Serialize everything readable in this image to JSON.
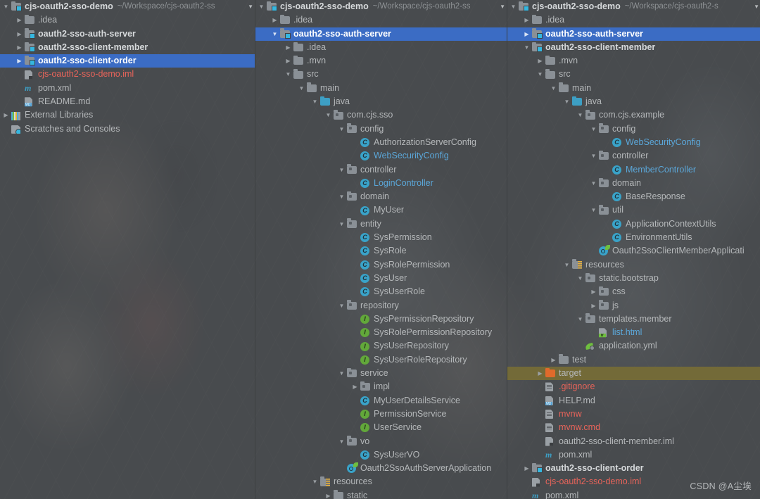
{
  "app": {
    "theme": "intellij-darcula",
    "colors": {
      "background": "#484b4e",
      "selection": "#3b6cc4",
      "target_highlight": "#736a38",
      "text": "#b5b8ba",
      "red_file": "#e8645a",
      "blue_file": "#5ba7d9",
      "class_icon": "#39a3c9",
      "interface_icon": "#62a83a"
    },
    "watermark": "CSDN @A尘埃"
  },
  "panels": [
    {
      "id": "panel-left",
      "header": {
        "label": "cjs-oauth2-sso-demo",
        "path": "~/Workspace/cjs-oauth2-ss",
        "caret": "▼"
      },
      "rows": [
        {
          "depth": 0,
          "arrow": "▼",
          "icon": "module-icon",
          "label": "cjs-oauth2-sso-demo",
          "sub": "~/Workspace/cjs-oauth2-ss",
          "bold": true,
          "color": "white"
        },
        {
          "depth": 1,
          "arrow": "▶",
          "icon": "folder-icon",
          "label": ".idea",
          "color": "plain"
        },
        {
          "depth": 1,
          "arrow": "▶",
          "icon": "module-icon",
          "label": "oauth2-sso-auth-server",
          "bold": true,
          "color": "white"
        },
        {
          "depth": 1,
          "arrow": "▶",
          "icon": "module-icon",
          "label": "oauth2-sso-client-member",
          "bold": true,
          "color": "white"
        },
        {
          "depth": 1,
          "arrow": "▶",
          "icon": "module-icon",
          "label": "oauth2-sso-client-order",
          "bold": true,
          "color": "white",
          "selected": true
        },
        {
          "depth": 1,
          "arrow": "",
          "icon": "iml-file-icon",
          "label": "cjs-oauth2-sso-demo.iml",
          "color": "red"
        },
        {
          "depth": 1,
          "arrow": "",
          "icon": "maven-pom-icon",
          "label": "pom.xml",
          "color": "plain"
        },
        {
          "depth": 1,
          "arrow": "",
          "icon": "markdown-file-icon",
          "label": "README.md",
          "color": "plain"
        },
        {
          "depth": 0,
          "arrow": "▶",
          "icon": "external-libraries-icon",
          "label": "External Libraries",
          "color": "plain"
        },
        {
          "depth": 0,
          "arrow": "",
          "icon": "scratches-icon",
          "label": "Scratches and Consoles",
          "color": "plain"
        }
      ]
    },
    {
      "id": "panel-middle",
      "header": {
        "label": "cjs-oauth2-sso-demo",
        "path": "~/Workspace/cjs-oauth2-ss",
        "caret": "▼"
      },
      "rows": [
        {
          "depth": 0,
          "arrow": "▼",
          "icon": "module-icon",
          "label": "cjs-oauth2-sso-demo",
          "sub": "~/Workspace/cjs-oauth2-ss",
          "bold": true,
          "color": "white"
        },
        {
          "depth": 1,
          "arrow": "▶",
          "icon": "folder-icon",
          "label": ".idea",
          "color": "plain"
        },
        {
          "depth": 1,
          "arrow": "▼",
          "icon": "module-icon",
          "label": "oauth2-sso-auth-server",
          "bold": true,
          "color": "white",
          "selected": true
        },
        {
          "depth": 2,
          "arrow": "▶",
          "icon": "folder-icon",
          "label": ".idea",
          "color": "plain"
        },
        {
          "depth": 2,
          "arrow": "▶",
          "icon": "folder-icon",
          "label": ".mvn",
          "color": "plain"
        },
        {
          "depth": 2,
          "arrow": "▼",
          "icon": "folder-icon",
          "label": "src",
          "color": "plain"
        },
        {
          "depth": 3,
          "arrow": "▼",
          "icon": "folder-icon",
          "label": "main",
          "color": "plain"
        },
        {
          "depth": 4,
          "arrow": "▼",
          "icon": "source-folder-icon",
          "label": "java",
          "color": "plain"
        },
        {
          "depth": 5,
          "arrow": "▼",
          "icon": "package-icon",
          "label": "com.cjs.sso",
          "color": "plain"
        },
        {
          "depth": 6,
          "arrow": "▼",
          "icon": "package-icon",
          "label": "config",
          "color": "plain"
        },
        {
          "depth": 7,
          "arrow": "",
          "icon": "class-icon",
          "label": "AuthorizationServerConfig",
          "color": "plain"
        },
        {
          "depth": 7,
          "arrow": "",
          "icon": "class-icon",
          "label": "WebSecurityConfig",
          "color": "blue"
        },
        {
          "depth": 6,
          "arrow": "▼",
          "icon": "package-icon",
          "label": "controller",
          "color": "plain"
        },
        {
          "depth": 7,
          "arrow": "",
          "icon": "class-icon",
          "label": "LoginController",
          "color": "blue"
        },
        {
          "depth": 6,
          "arrow": "▼",
          "icon": "package-icon",
          "label": "domain",
          "color": "plain"
        },
        {
          "depth": 7,
          "arrow": "",
          "icon": "class-icon",
          "label": "MyUser",
          "color": "plain"
        },
        {
          "depth": 6,
          "arrow": "▼",
          "icon": "package-icon",
          "label": "entity",
          "color": "plain"
        },
        {
          "depth": 7,
          "arrow": "",
          "icon": "class-icon",
          "label": "SysPermission",
          "color": "plain"
        },
        {
          "depth": 7,
          "arrow": "",
          "icon": "class-icon",
          "label": "SysRole",
          "color": "plain"
        },
        {
          "depth": 7,
          "arrow": "",
          "icon": "class-icon",
          "label": "SysRolePermission",
          "color": "plain"
        },
        {
          "depth": 7,
          "arrow": "",
          "icon": "class-icon",
          "label": "SysUser",
          "color": "plain"
        },
        {
          "depth": 7,
          "arrow": "",
          "icon": "class-icon",
          "label": "SysUserRole",
          "color": "plain"
        },
        {
          "depth": 6,
          "arrow": "▼",
          "icon": "package-icon",
          "label": "repository",
          "color": "plain"
        },
        {
          "depth": 7,
          "arrow": "",
          "icon": "interface-icon",
          "label": "SysPermissionRepository",
          "color": "plain"
        },
        {
          "depth": 7,
          "arrow": "",
          "icon": "interface-icon",
          "label": "SysRolePermissionRepository",
          "color": "plain"
        },
        {
          "depth": 7,
          "arrow": "",
          "icon": "interface-icon",
          "label": "SysUserRepository",
          "color": "plain"
        },
        {
          "depth": 7,
          "arrow": "",
          "icon": "interface-icon",
          "label": "SysUserRoleRepository",
          "color": "plain"
        },
        {
          "depth": 6,
          "arrow": "▼",
          "icon": "package-icon",
          "label": "service",
          "color": "plain"
        },
        {
          "depth": 7,
          "arrow": "▶",
          "icon": "package-icon",
          "label": "impl",
          "color": "plain"
        },
        {
          "depth": 7,
          "arrow": "",
          "icon": "class-icon",
          "label": "MyUserDetailsService",
          "color": "plain"
        },
        {
          "depth": 7,
          "arrow": "",
          "icon": "interface-icon",
          "label": "PermissionService",
          "color": "plain"
        },
        {
          "depth": 7,
          "arrow": "",
          "icon": "interface-icon",
          "label": "UserService",
          "color": "plain"
        },
        {
          "depth": 6,
          "arrow": "▼",
          "icon": "package-icon",
          "label": "vo",
          "color": "plain"
        },
        {
          "depth": 7,
          "arrow": "",
          "icon": "class-icon",
          "label": "SysUserVO",
          "color": "plain"
        },
        {
          "depth": 6,
          "arrow": "",
          "icon": "spring-boot-app-icon",
          "label": "Oauth2SsoAuthServerApplication",
          "color": "plain"
        },
        {
          "depth": 4,
          "arrow": "▼",
          "icon": "resources-folder-icon",
          "label": "resources",
          "color": "plain"
        },
        {
          "depth": 5,
          "arrow": "▶",
          "icon": "folder-icon",
          "label": "static",
          "color": "plain",
          "clipped": true
        }
      ]
    },
    {
      "id": "panel-right",
      "header": {
        "label": "cjs-oauth2-sso-demo",
        "path": "~/Workspace/cjs-oauth2-s",
        "caret": "▼"
      },
      "rows": [
        {
          "depth": 0,
          "arrow": "▼",
          "icon": "module-icon",
          "label": "cjs-oauth2-sso-demo",
          "sub": "~/Workspace/cjs-oauth2-s",
          "bold": true,
          "color": "white"
        },
        {
          "depth": 1,
          "arrow": "▶",
          "icon": "folder-icon",
          "label": ".idea",
          "color": "plain"
        },
        {
          "depth": 1,
          "arrow": "▶",
          "icon": "module-icon",
          "label": "oauth2-sso-auth-server",
          "bold": true,
          "color": "white",
          "selected": true
        },
        {
          "depth": 1,
          "arrow": "▼",
          "icon": "module-icon",
          "label": "oauth2-sso-client-member",
          "bold": true,
          "color": "white"
        },
        {
          "depth": 2,
          "arrow": "▶",
          "icon": "folder-icon",
          "label": ".mvn",
          "color": "plain"
        },
        {
          "depth": 2,
          "arrow": "▼",
          "icon": "folder-icon",
          "label": "src",
          "color": "plain"
        },
        {
          "depth": 3,
          "arrow": "▼",
          "icon": "folder-icon",
          "label": "main",
          "color": "plain"
        },
        {
          "depth": 4,
          "arrow": "▼",
          "icon": "source-folder-icon",
          "label": "java",
          "color": "plain"
        },
        {
          "depth": 5,
          "arrow": "▼",
          "icon": "package-icon",
          "label": "com.cjs.example",
          "color": "plain"
        },
        {
          "depth": 6,
          "arrow": "▼",
          "icon": "package-icon",
          "label": "config",
          "color": "plain"
        },
        {
          "depth": 7,
          "arrow": "",
          "icon": "class-icon",
          "label": "WebSecurityConfig",
          "color": "blue"
        },
        {
          "depth": 6,
          "arrow": "▼",
          "icon": "package-icon",
          "label": "controller",
          "color": "plain"
        },
        {
          "depth": 7,
          "arrow": "",
          "icon": "class-icon",
          "label": "MemberController",
          "color": "blue"
        },
        {
          "depth": 6,
          "arrow": "▼",
          "icon": "package-icon",
          "label": "domain",
          "color": "plain"
        },
        {
          "depth": 7,
          "arrow": "",
          "icon": "class-icon",
          "label": "BaseResponse",
          "color": "plain"
        },
        {
          "depth": 6,
          "arrow": "▼",
          "icon": "package-icon",
          "label": "util",
          "color": "plain"
        },
        {
          "depth": 7,
          "arrow": "",
          "icon": "class-icon",
          "label": "ApplicationContextUtils",
          "color": "plain"
        },
        {
          "depth": 7,
          "arrow": "",
          "icon": "class-icon",
          "label": "EnvironmentUtils",
          "color": "plain"
        },
        {
          "depth": 6,
          "arrow": "",
          "icon": "spring-boot-app-icon",
          "label": "Oauth2SsoClientMemberApplicati",
          "color": "plain"
        },
        {
          "depth": 4,
          "arrow": "▼",
          "icon": "resources-folder-icon",
          "label": "resources",
          "color": "plain"
        },
        {
          "depth": 5,
          "arrow": "▼",
          "icon": "package-icon",
          "label": "static.bootstrap",
          "color": "plain"
        },
        {
          "depth": 6,
          "arrow": "▶",
          "icon": "package-icon",
          "label": "css",
          "color": "plain"
        },
        {
          "depth": 6,
          "arrow": "▶",
          "icon": "package-icon",
          "label": "js",
          "color": "plain"
        },
        {
          "depth": 5,
          "arrow": "▼",
          "icon": "package-icon",
          "label": "templates.member",
          "color": "plain"
        },
        {
          "depth": 6,
          "arrow": "",
          "icon": "html-file-icon",
          "label": "list.html",
          "color": "blue"
        },
        {
          "depth": 5,
          "arrow": "",
          "icon": "spring-yml-icon",
          "label": "application.yml",
          "color": "plain"
        },
        {
          "depth": 3,
          "arrow": "▶",
          "icon": "folder-icon",
          "label": "test",
          "color": "plain"
        },
        {
          "depth": 2,
          "arrow": "▶",
          "icon": "target-folder-icon",
          "label": "target",
          "color": "plain",
          "highlight": "target"
        },
        {
          "depth": 2,
          "arrow": "",
          "icon": "file-icon",
          "label": ".gitignore",
          "color": "red"
        },
        {
          "depth": 2,
          "arrow": "",
          "icon": "markdown-file-icon",
          "label": "HELP.md",
          "color": "plain"
        },
        {
          "depth": 2,
          "arrow": "",
          "icon": "file-icon",
          "label": "mvnw",
          "color": "red"
        },
        {
          "depth": 2,
          "arrow": "",
          "icon": "file-icon",
          "label": "mvnw.cmd",
          "color": "red"
        },
        {
          "depth": 2,
          "arrow": "",
          "icon": "iml-file-icon",
          "label": "oauth2-sso-client-member.iml",
          "color": "plain"
        },
        {
          "depth": 2,
          "arrow": "",
          "icon": "maven-pom-icon",
          "label": "pom.xml",
          "color": "plain"
        },
        {
          "depth": 1,
          "arrow": "▶",
          "icon": "module-icon",
          "label": "oauth2-sso-client-order",
          "bold": true,
          "color": "white"
        },
        {
          "depth": 1,
          "arrow": "",
          "icon": "iml-file-icon",
          "label": "cjs-oauth2-sso-demo.iml",
          "color": "red"
        },
        {
          "depth": 1,
          "arrow": "",
          "icon": "maven-pom-icon",
          "label": "pom.xml",
          "color": "plain",
          "clipped": true
        }
      ]
    }
  ]
}
